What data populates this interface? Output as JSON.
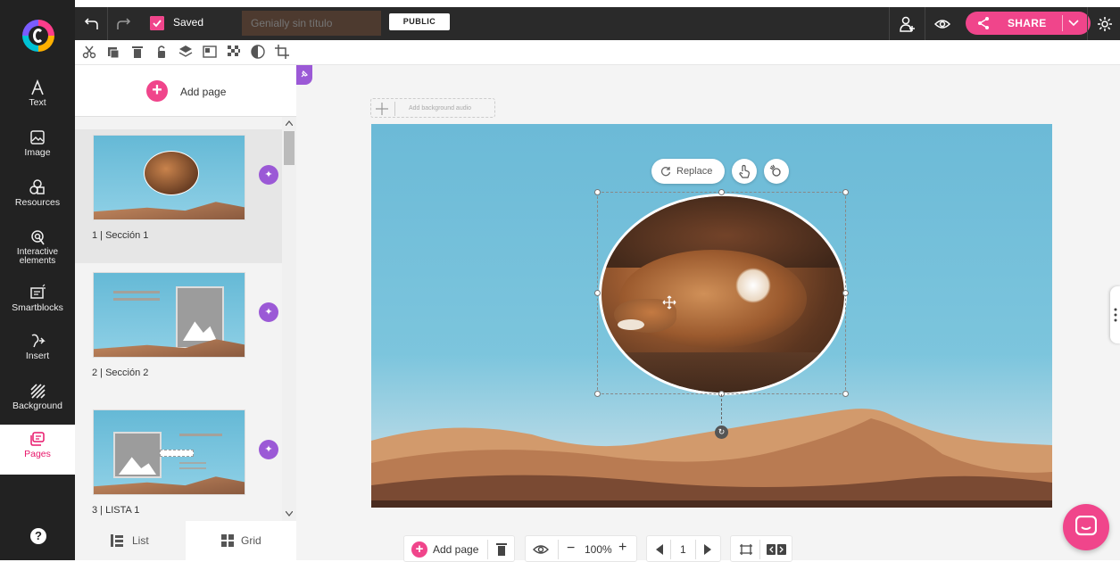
{
  "rail": {
    "items": [
      {
        "label": "Text",
        "icon": "text-icon"
      },
      {
        "label": "Image",
        "icon": "image-icon"
      },
      {
        "label": "Resources",
        "icon": "resources-icon"
      },
      {
        "label": "Interactive elements",
        "icon": "interactive-icon"
      },
      {
        "label": "Smartblocks",
        "icon": "smartblocks-icon"
      },
      {
        "label": "Insert",
        "icon": "insert-icon"
      },
      {
        "label": "Background",
        "icon": "background-icon"
      },
      {
        "label": "Pages",
        "icon": "pages-icon"
      }
    ],
    "help": "?"
  },
  "topbar": {
    "saved": "Saved",
    "title_placeholder": "Genially sin título",
    "public": "PUBLIC",
    "share": "SHARE"
  },
  "panel": {
    "add_page": "Add page",
    "pages": [
      {
        "label": "1 | Sección 1",
        "selected": true
      },
      {
        "label": "2 | Sección 2",
        "selected": false
      },
      {
        "label": "3 | LISTA  1",
        "selected": false
      }
    ],
    "view_list": "List",
    "view_grid": "Grid"
  },
  "canvas": {
    "bg_audio": "Add background audio",
    "replace": "Replace"
  },
  "bottom": {
    "add_page": "Add page",
    "zoom": "100%",
    "page_number": "1"
  },
  "colors": {
    "accent": "#f0458b",
    "magic": "#9b59d6",
    "rail_bg": "#222222",
    "sky": "#6cbad7"
  }
}
